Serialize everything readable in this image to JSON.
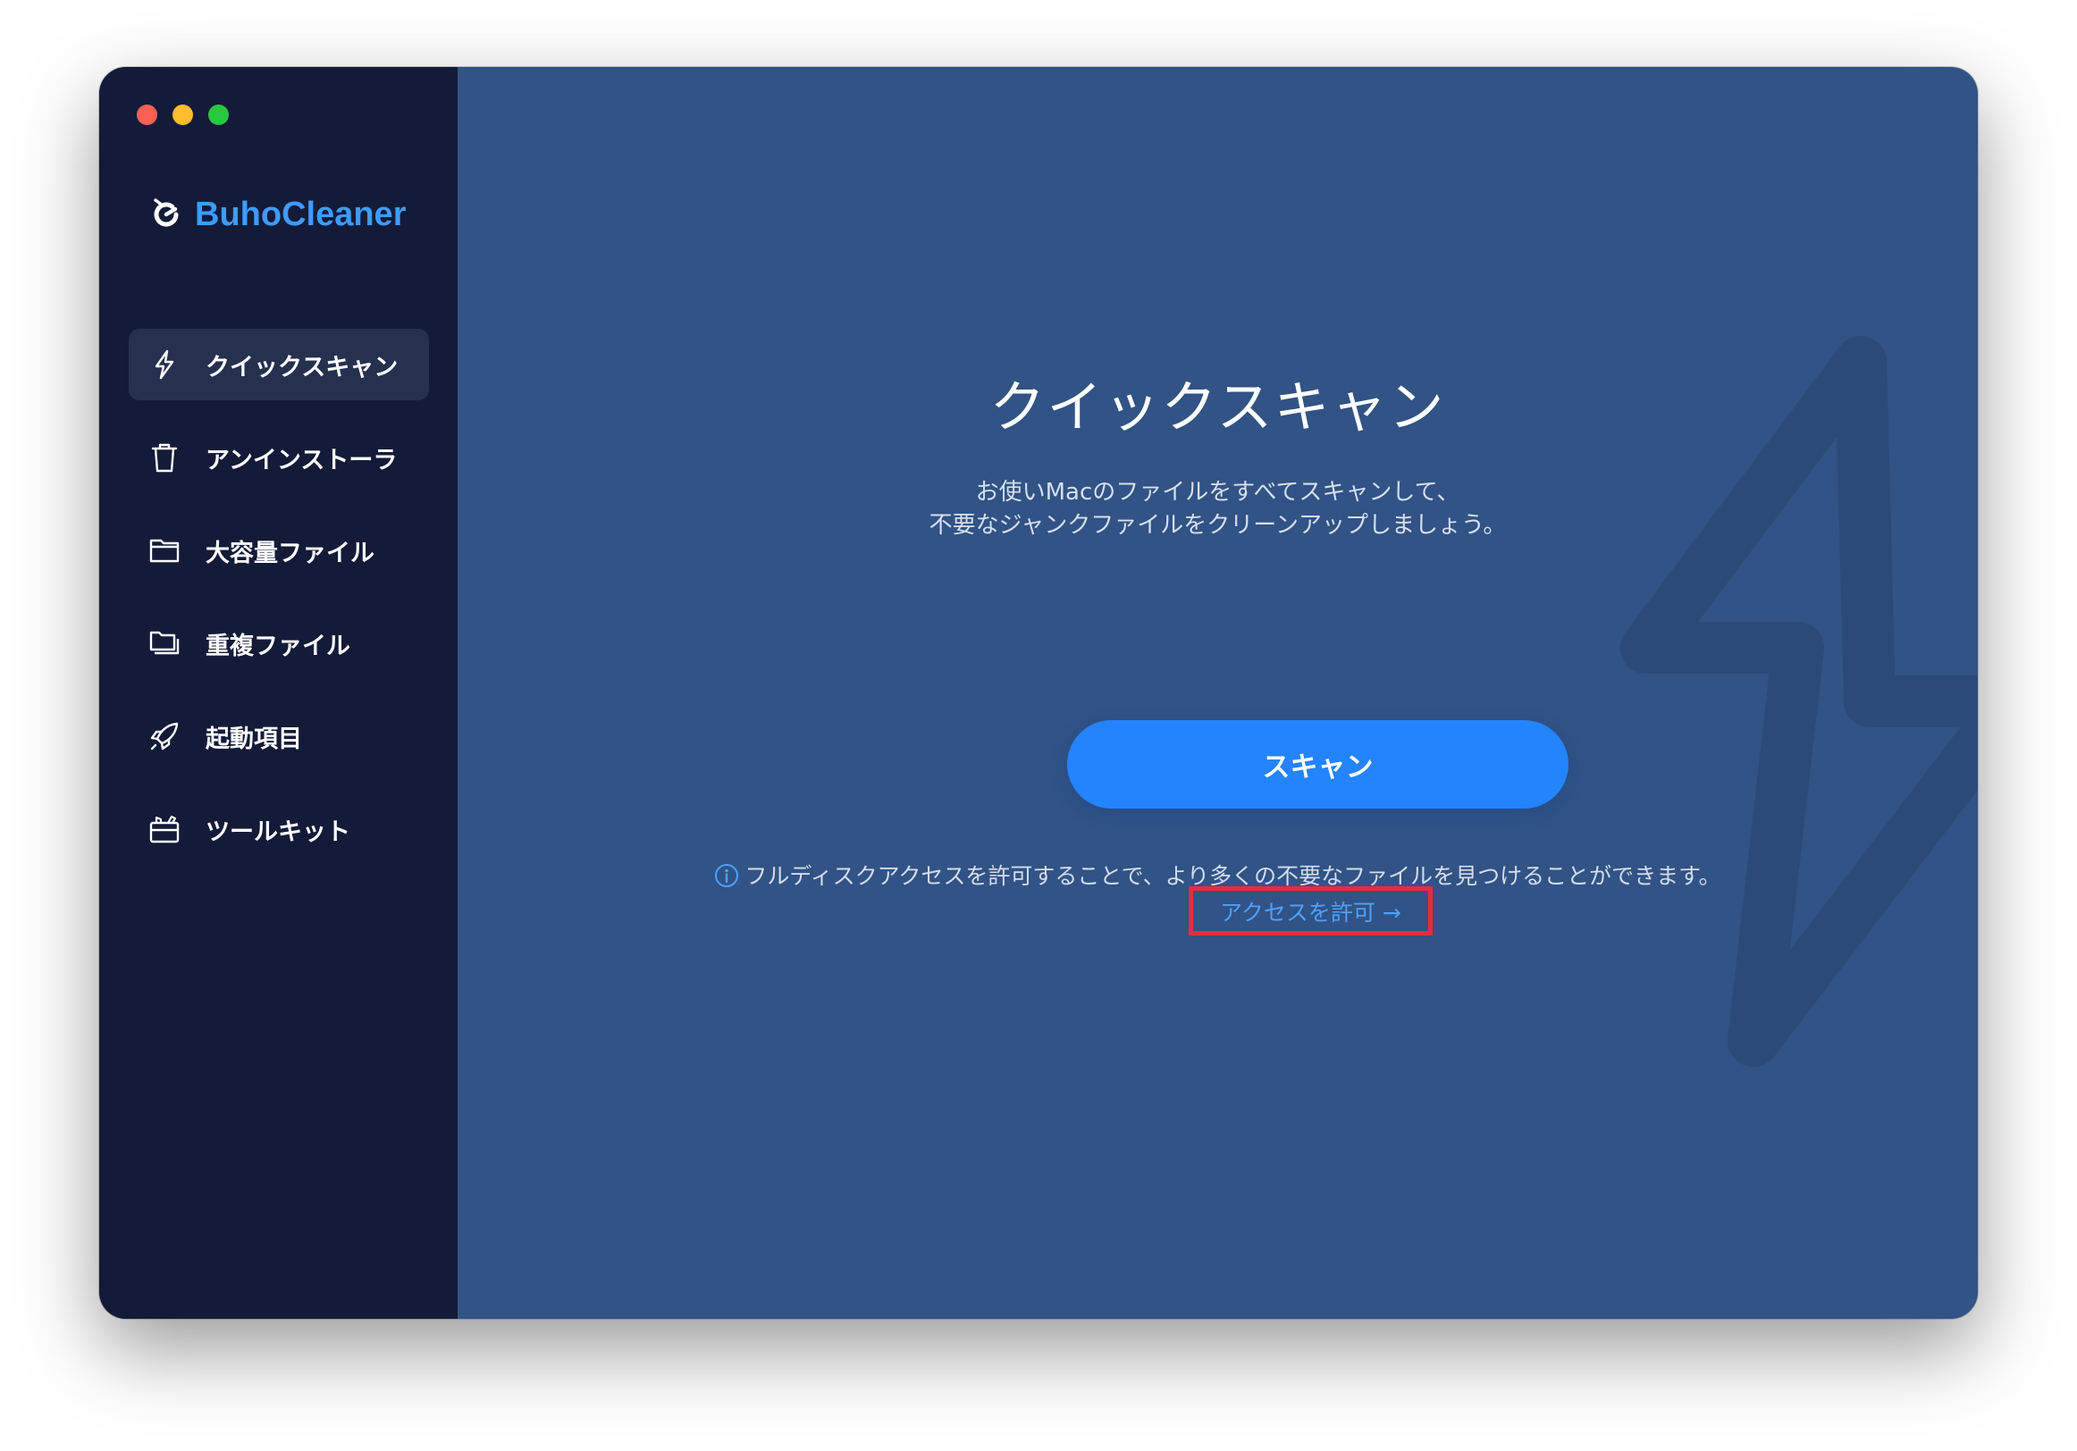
{
  "app": {
    "name": "BuhoCleaner"
  },
  "sidebar": {
    "items": [
      {
        "label": "クイックスキャン",
        "icon": "lightning-icon",
        "active": true
      },
      {
        "label": "アンインストーラ",
        "icon": "trash-icon",
        "active": false
      },
      {
        "label": "大容量ファイル",
        "icon": "folder-icon",
        "active": false
      },
      {
        "label": "重複ファイル",
        "icon": "duplicate-folder-icon",
        "active": false
      },
      {
        "label": "起動項目",
        "icon": "rocket-icon",
        "active": false
      },
      {
        "label": "ツールキット",
        "icon": "toolbox-icon",
        "active": false
      }
    ]
  },
  "main": {
    "title": "クイックスキャン",
    "description_line1": "お使いMacのファイルをすべてスキャンして、",
    "description_line2": "不要なジャンクファイルをクリーンアップしましょう。",
    "scan_button": "スキャン",
    "notice": "フルディスクアクセスを許可することで、より多くの不要なファイルを見つけることができます。",
    "access_link": "アクセスを許可 →"
  },
  "colors": {
    "sidebar_bg": "#131b38",
    "main_bg": "#315385",
    "accent": "#2384fe",
    "brand": "#3e9bff",
    "highlight_box": "#ee2942"
  }
}
